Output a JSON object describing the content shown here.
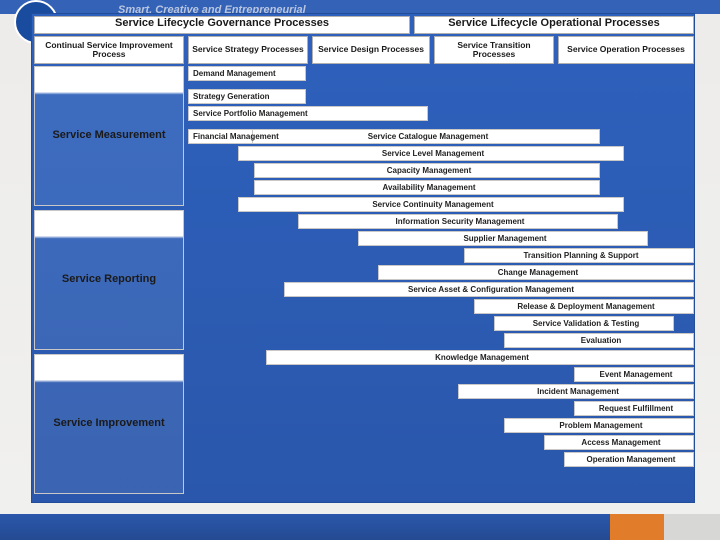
{
  "slogan": "Smart, Creative and Entrepreneurial",
  "logo": "",
  "topHeaders": {
    "governance": "Service Lifecycle Governance Processes",
    "operational": "Service Lifecycle Operational Processes"
  },
  "columns": {
    "c1": "Continual Service Improvement Process",
    "c2": "Service Strategy Processes",
    "c3": "Service Design Processes",
    "c4": "Service Transition Processes",
    "c5": "Service Operation Processes"
  },
  "leftBoxes": {
    "b1": "Service Measurement",
    "b2": "Service Reporting",
    "b3": "Service Improvement"
  },
  "bars": {
    "demand": "Demand Management",
    "stratGen": "Strategy Generation",
    "portfolio": "Service Portfolio Management",
    "finance": "Financial Management",
    "catalog": "Service Catalogue Management",
    "slm": "Service Level Management",
    "capacity": "Capacity Management",
    "availability": "Availability Management",
    "continuity": "Service Continuity Management",
    "infosec": "Information Security Management",
    "supplier": "Supplier Management",
    "tps": "Transition Planning & Support",
    "change": "Change Management",
    "sacm": "Service Asset & Configuration Management",
    "rdm": "Release & Deployment Management",
    "svt": "Service Validation & Testing",
    "eval": "Evaluation",
    "knowledge": "Knowledge Management",
    "event": "Event Management",
    "incident": "Incident Management",
    "request": "Request Fulfillment",
    "problem": "Problem Management",
    "access": "Access Management",
    "opsmgmt": "Operation Management"
  }
}
